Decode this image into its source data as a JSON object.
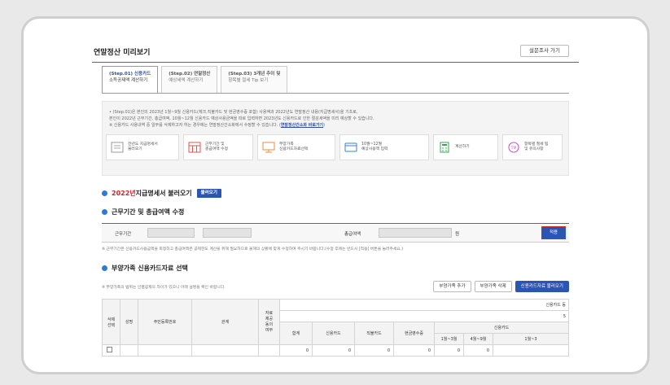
{
  "page": {
    "title": "연말정산 미리보기",
    "survey_button": "설문조사 가기"
  },
  "tabs": [
    {
      "step": "(Step.01) 신용카드",
      "label": "소득공제액 계산하기"
    },
    {
      "step": "(Step.02) 연말정산",
      "label": "예상세액 계산하기"
    },
    {
      "step": "(Step.03) 3개년 추이 및",
      "label": "항목별 절세 Tip 보기"
    }
  ],
  "notice": {
    "line1": "• (Step.01)은 본인의 2023년 1월~9월 신용카드(체크,직불카드 및 현금영수증 포함) 사용액과 2022년도 연말정산 내용(지급명세서)을 기초로,",
    "line2": "본인이 2022년 근무기간, 총급여액, 10월~12월 신용카드 예상사용금액을 따로 입력하면 2023년도 신용카드로 인한 절감세액을 미리 예상할 수 있습니다.",
    "line3": "※ 신용카드 사용내역 중 일부를 삭제하고자 하는 경우에는 연말정산간소화에서 수정할 수 있습니다. (",
    "line3_link": "연말정산간소화 바로가기",
    "line3_end": ")"
  },
  "steps": [
    {
      "label1": "전년도 지급명세서",
      "label2": "불러오기"
    },
    {
      "label1": "근무기간 및",
      "label2": "총급여액 수정"
    },
    {
      "label1": "부양가족",
      "label2": "신용카드자료선택"
    },
    {
      "label1": "10월~12월",
      "label2": "예상사용액 입력"
    },
    {
      "label1": "계산하기",
      "label2": ""
    },
    {
      "label1": "항목별 절세 팁",
      "label2": "및 유의사항"
    }
  ],
  "section1": {
    "year": "2022년",
    "title": " 지급명세서 불러오기",
    "button": "불러오기"
  },
  "section2": {
    "title": "근무기간 및 총급여액 수정",
    "work_period_label": "근무기간",
    "total_salary_label": "총급여액",
    "won": "원",
    "apply_button": "적용",
    "hint": "※ 근무기간은 신용카드사용금액을 회정하고 총급여액은 공제한도 계산을 위해 필요하므로 올해의 상황에 맞게 수정하여 주시기 바랍니다.(수정 후에는 반드시 [적용] 버튼을 눌러주세요.)"
  },
  "section3": {
    "title": "부양가족 신용카드자료 선택",
    "hint": "※ 부양가족의 범위는 인별공제의 차이가 있으니 아래 설명을 확인 바랍니다.",
    "add_button": "부양가족 추가",
    "delete_button": "부양가족 삭제",
    "load_button": "신용카드자료 불러오기"
  },
  "table": {
    "credit_card_group": "신용카드 등",
    "col_select": "삭제\n선택",
    "col_name": "성명",
    "col_rrn": "주민등록번호",
    "col_relation": "관계",
    "col_consent": "자료\n제공\n동의\n여부",
    "col_total": "합계",
    "col_credit": "신용카드",
    "col_check": "직불카드",
    "col_cash": "현금영수증",
    "col_credit2": "신용카드",
    "col_jan_mar": "1월~3월",
    "col_apr_sep": "4월~9월",
    "col_jan_x": "1월~3",
    "five": "5",
    "row": {
      "total": "0",
      "credit": "0",
      "check": "0",
      "cash": "0",
      "c1": "0",
      "c2": "0"
    }
  }
}
